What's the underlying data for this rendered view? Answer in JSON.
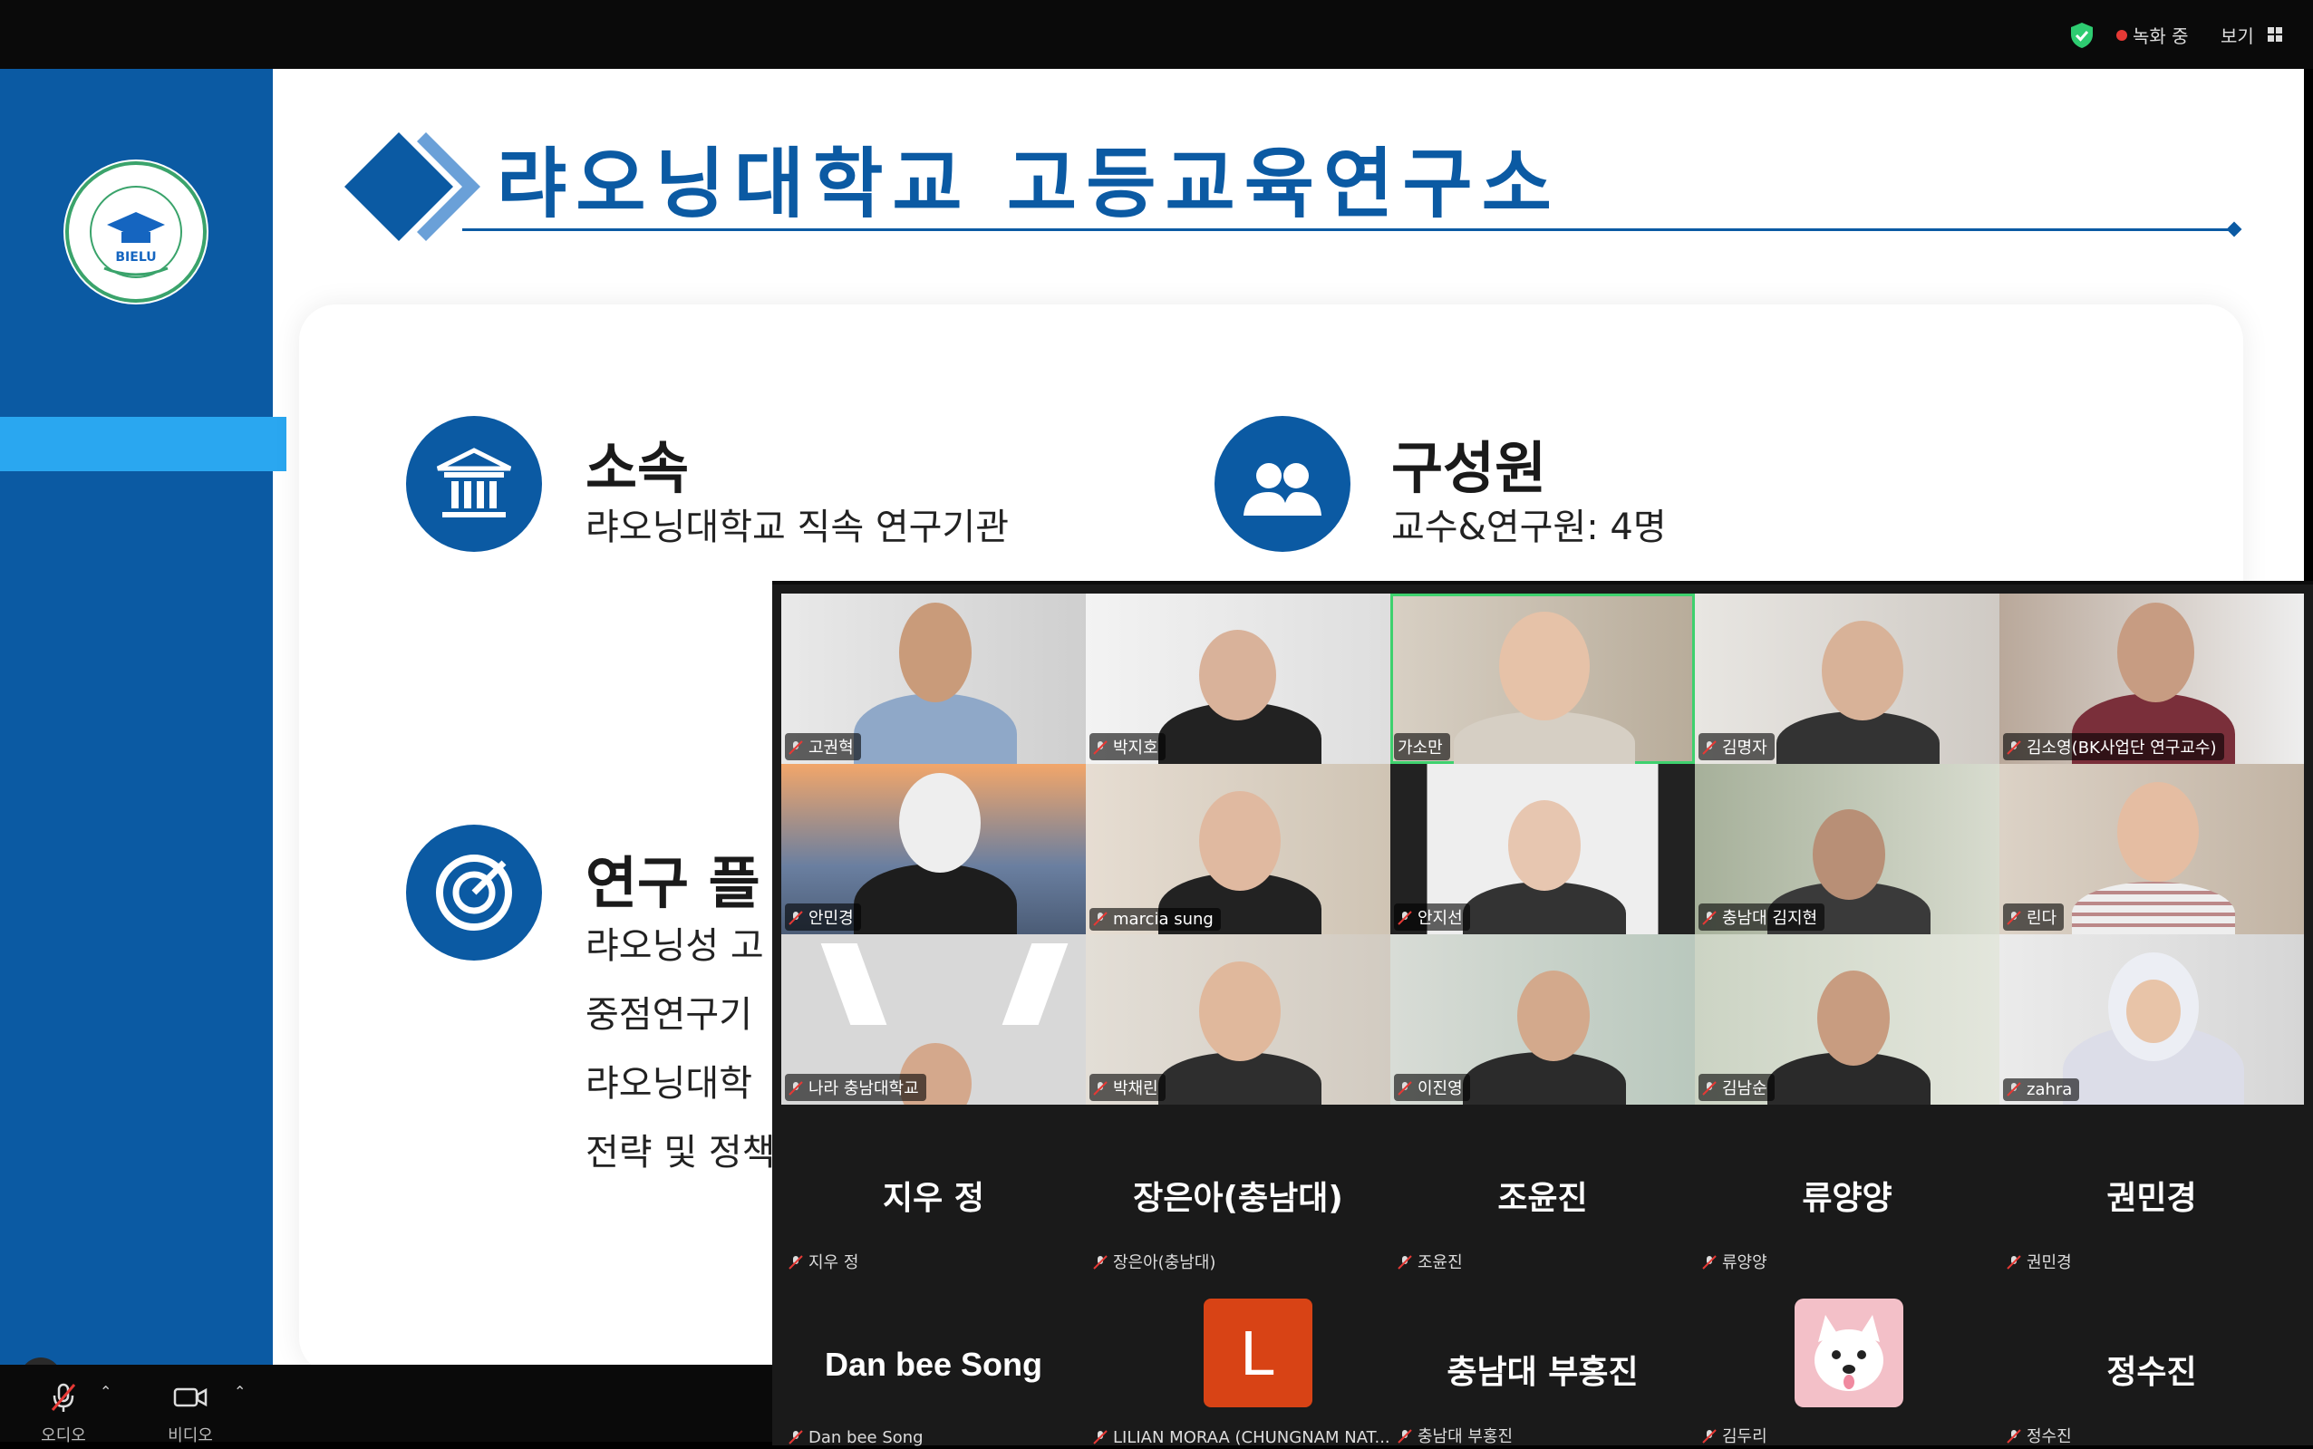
{
  "topbar": {
    "recording_label": "녹화 중",
    "view_label": "보기",
    "colors": {
      "shield": "#2ecc71",
      "recording_dot": "#e53935"
    }
  },
  "slide": {
    "title": "랴오닝대학교 고등교육연구소",
    "logo_text": "BIELU",
    "sections": [
      {
        "icon": "building-icon",
        "title": "소속",
        "lines": [
          "랴오닝대학교 직속 연구기관"
        ]
      },
      {
        "icon": "people-icon",
        "title": "구성원",
        "lines": [
          "교수&연구원: 4명"
        ]
      },
      {
        "icon": "target-icon",
        "title": "연구 플",
        "lines": [
          "랴오닝성 고",
          "중점연구기",
          "랴오닝대학",
          "전략 및 정책"
        ]
      }
    ],
    "colors": {
      "primary": "#0b5aa3",
      "accent": "#2aa7f0"
    }
  },
  "controls": {
    "audio_label": "오디오",
    "video_label": "비디오"
  },
  "video_tiles": [
    {
      "name": "고권혁"
    },
    {
      "name": "박지호"
    },
    {
      "name": "가소만",
      "active": true
    },
    {
      "name": "김명자"
    },
    {
      "name": "김소영(BK사업단 연구교수)"
    },
    {
      "name": "안민경"
    },
    {
      "name": "marcia sung"
    },
    {
      "name": "안지선"
    },
    {
      "name": "충남대 김지현"
    },
    {
      "name": "린다"
    },
    {
      "name": "나라 충남대학교"
    },
    {
      "name": "박채린"
    },
    {
      "name": "이진영"
    },
    {
      "name": "김남순"
    },
    {
      "name": "zahra"
    }
  ],
  "name_tiles": [
    {
      "display": "지우 정",
      "name": "지우 정"
    },
    {
      "display": "장은아(충남대)",
      "name": "장은아(충남대)"
    },
    {
      "display": "조윤진",
      "name": "조윤진"
    },
    {
      "display": "류양양",
      "name": "류양양"
    },
    {
      "display": "권민경",
      "name": "권민경"
    },
    {
      "display": "Dan bee Song",
      "name": "Dan bee Song"
    },
    {
      "display": "",
      "avatar_letter": "L",
      "name": "LILIAN MORAA (CHUNGNAM NAT..."
    },
    {
      "display": "충남대 부홍진",
      "name": "충남대 부홍진"
    },
    {
      "display": "",
      "avatar": "dog",
      "name": "김두리"
    },
    {
      "display": "정수진",
      "name": "정수진"
    }
  ]
}
